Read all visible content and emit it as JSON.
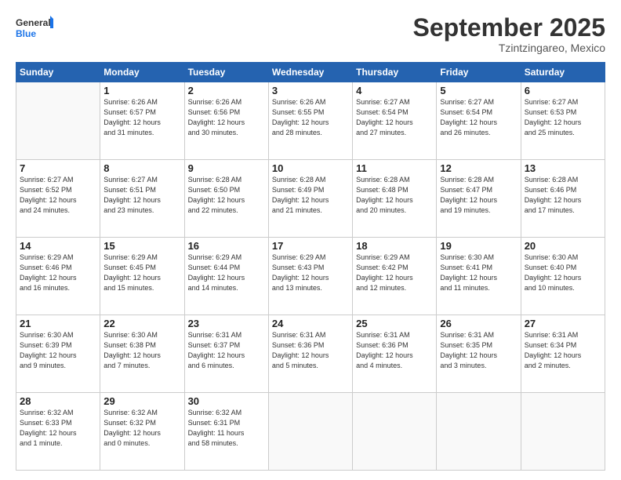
{
  "header": {
    "logo_line1": "General",
    "logo_line2": "Blue",
    "month": "September 2025",
    "location": "Tzintzingareo, Mexico"
  },
  "days_of_week": [
    "Sunday",
    "Monday",
    "Tuesday",
    "Wednesday",
    "Thursday",
    "Friday",
    "Saturday"
  ],
  "weeks": [
    [
      {
        "day": "",
        "info": ""
      },
      {
        "day": "1",
        "info": "Sunrise: 6:26 AM\nSunset: 6:57 PM\nDaylight: 12 hours\nand 31 minutes."
      },
      {
        "day": "2",
        "info": "Sunrise: 6:26 AM\nSunset: 6:56 PM\nDaylight: 12 hours\nand 30 minutes."
      },
      {
        "day": "3",
        "info": "Sunrise: 6:26 AM\nSunset: 6:55 PM\nDaylight: 12 hours\nand 28 minutes."
      },
      {
        "day": "4",
        "info": "Sunrise: 6:27 AM\nSunset: 6:54 PM\nDaylight: 12 hours\nand 27 minutes."
      },
      {
        "day": "5",
        "info": "Sunrise: 6:27 AM\nSunset: 6:54 PM\nDaylight: 12 hours\nand 26 minutes."
      },
      {
        "day": "6",
        "info": "Sunrise: 6:27 AM\nSunset: 6:53 PM\nDaylight: 12 hours\nand 25 minutes."
      }
    ],
    [
      {
        "day": "7",
        "info": "Sunrise: 6:27 AM\nSunset: 6:52 PM\nDaylight: 12 hours\nand 24 minutes."
      },
      {
        "day": "8",
        "info": "Sunrise: 6:27 AM\nSunset: 6:51 PM\nDaylight: 12 hours\nand 23 minutes."
      },
      {
        "day": "9",
        "info": "Sunrise: 6:28 AM\nSunset: 6:50 PM\nDaylight: 12 hours\nand 22 minutes."
      },
      {
        "day": "10",
        "info": "Sunrise: 6:28 AM\nSunset: 6:49 PM\nDaylight: 12 hours\nand 21 minutes."
      },
      {
        "day": "11",
        "info": "Sunrise: 6:28 AM\nSunset: 6:48 PM\nDaylight: 12 hours\nand 20 minutes."
      },
      {
        "day": "12",
        "info": "Sunrise: 6:28 AM\nSunset: 6:47 PM\nDaylight: 12 hours\nand 19 minutes."
      },
      {
        "day": "13",
        "info": "Sunrise: 6:28 AM\nSunset: 6:46 PM\nDaylight: 12 hours\nand 17 minutes."
      }
    ],
    [
      {
        "day": "14",
        "info": "Sunrise: 6:29 AM\nSunset: 6:46 PM\nDaylight: 12 hours\nand 16 minutes."
      },
      {
        "day": "15",
        "info": "Sunrise: 6:29 AM\nSunset: 6:45 PM\nDaylight: 12 hours\nand 15 minutes."
      },
      {
        "day": "16",
        "info": "Sunrise: 6:29 AM\nSunset: 6:44 PM\nDaylight: 12 hours\nand 14 minutes."
      },
      {
        "day": "17",
        "info": "Sunrise: 6:29 AM\nSunset: 6:43 PM\nDaylight: 12 hours\nand 13 minutes."
      },
      {
        "day": "18",
        "info": "Sunrise: 6:29 AM\nSunset: 6:42 PM\nDaylight: 12 hours\nand 12 minutes."
      },
      {
        "day": "19",
        "info": "Sunrise: 6:30 AM\nSunset: 6:41 PM\nDaylight: 12 hours\nand 11 minutes."
      },
      {
        "day": "20",
        "info": "Sunrise: 6:30 AM\nSunset: 6:40 PM\nDaylight: 12 hours\nand 10 minutes."
      }
    ],
    [
      {
        "day": "21",
        "info": "Sunrise: 6:30 AM\nSunset: 6:39 PM\nDaylight: 12 hours\nand 9 minutes."
      },
      {
        "day": "22",
        "info": "Sunrise: 6:30 AM\nSunset: 6:38 PM\nDaylight: 12 hours\nand 7 minutes."
      },
      {
        "day": "23",
        "info": "Sunrise: 6:31 AM\nSunset: 6:37 PM\nDaylight: 12 hours\nand 6 minutes."
      },
      {
        "day": "24",
        "info": "Sunrise: 6:31 AM\nSunset: 6:36 PM\nDaylight: 12 hours\nand 5 minutes."
      },
      {
        "day": "25",
        "info": "Sunrise: 6:31 AM\nSunset: 6:36 PM\nDaylight: 12 hours\nand 4 minutes."
      },
      {
        "day": "26",
        "info": "Sunrise: 6:31 AM\nSunset: 6:35 PM\nDaylight: 12 hours\nand 3 minutes."
      },
      {
        "day": "27",
        "info": "Sunrise: 6:31 AM\nSunset: 6:34 PM\nDaylight: 12 hours\nand 2 minutes."
      }
    ],
    [
      {
        "day": "28",
        "info": "Sunrise: 6:32 AM\nSunset: 6:33 PM\nDaylight: 12 hours\nand 1 minute."
      },
      {
        "day": "29",
        "info": "Sunrise: 6:32 AM\nSunset: 6:32 PM\nDaylight: 12 hours\nand 0 minutes."
      },
      {
        "day": "30",
        "info": "Sunrise: 6:32 AM\nSunset: 6:31 PM\nDaylight: 11 hours\nand 58 minutes."
      },
      {
        "day": "",
        "info": ""
      },
      {
        "day": "",
        "info": ""
      },
      {
        "day": "",
        "info": ""
      },
      {
        "day": "",
        "info": ""
      }
    ]
  ]
}
